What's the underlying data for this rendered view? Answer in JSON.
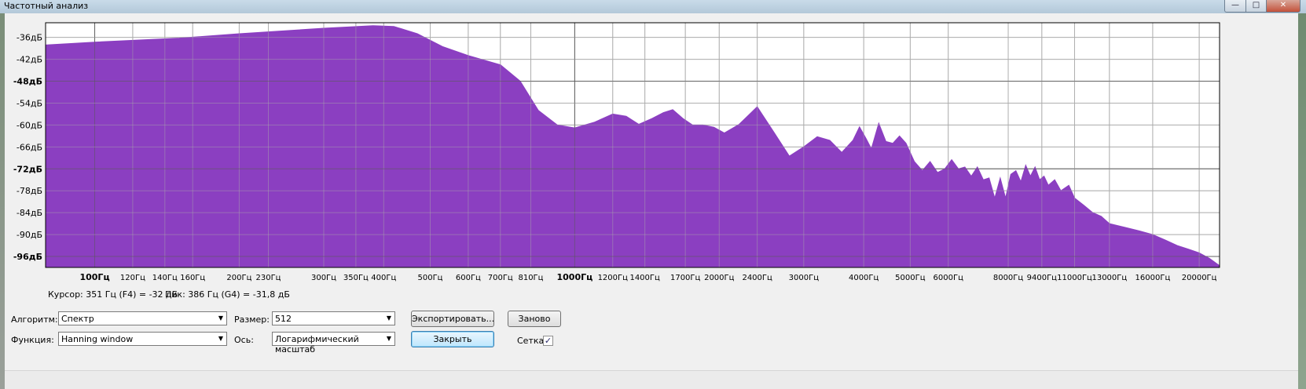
{
  "window": {
    "title": "Частотный анализ",
    "buttons": {
      "minimize": "—",
      "maximize": "□",
      "close": "✕"
    }
  },
  "spectrum": {
    "fill_color": "#8b3fc1",
    "y_labels": [
      "-36дБ",
      "-42дБ",
      "-48дБ",
      "-54дБ",
      "-60дБ",
      "-66дБ",
      "-72дБ",
      "-78дБ",
      "-84дБ",
      "-90дБ",
      "-96дБ"
    ],
    "y_bold": [
      "-48дБ",
      "-72дБ",
      "-96дБ"
    ],
    "x_labels": [
      {
        "hz": 100,
        "text": "100Гц",
        "bold": true
      },
      {
        "hz": 120,
        "text": "120Гц"
      },
      {
        "hz": 140,
        "text": "140Гц"
      },
      {
        "hz": 160,
        "text": "160Гц"
      },
      {
        "hz": 200,
        "text": "200Гц"
      },
      {
        "hz": 230,
        "text": "230Гц"
      },
      {
        "hz": 300,
        "text": "300Гц"
      },
      {
        "hz": 350,
        "text": "350Гц"
      },
      {
        "hz": 400,
        "text": "400Гц"
      },
      {
        "hz": 500,
        "text": "500Гц"
      },
      {
        "hz": 600,
        "text": "600Гц"
      },
      {
        "hz": 700,
        "text": "700Гц"
      },
      {
        "hz": 810,
        "text": "810Гц"
      },
      {
        "hz": 1000,
        "text": "1000Гц",
        "bold": true
      },
      {
        "hz": 1200,
        "text": "1200Гц"
      },
      {
        "hz": 1400,
        "text": "1400Гц"
      },
      {
        "hz": 1700,
        "text": "1700Гц"
      },
      {
        "hz": 2000,
        "text": "2000Гц"
      },
      {
        "hz": 2400,
        "text": "2400Гц"
      },
      {
        "hz": 3000,
        "text": "3000Гц"
      },
      {
        "hz": 4000,
        "text": "4000Гц"
      },
      {
        "hz": 5000,
        "text": "5000Гц"
      },
      {
        "hz": 6000,
        "text": "6000Гц"
      },
      {
        "hz": 8000,
        "text": "8000Гц"
      },
      {
        "hz": 9400,
        "text": "9400Гц"
      },
      {
        "hz": 11000,
        "text": "11000Гц"
      },
      {
        "hz": 13000,
        "text": "13000Гц"
      },
      {
        "hz": 16000,
        "text": "16000Гц"
      },
      {
        "hz": 20000,
        "text": "20000Гц"
      }
    ],
    "x_range_hz": [
      79,
      22050
    ],
    "y_range_db": [
      -32,
      -99
    ],
    "grid": true,
    "curve": [
      [
        79,
        -38.1
      ],
      [
        100,
        -37.3
      ],
      [
        150,
        -36.2
      ],
      [
        200,
        -35.0
      ],
      [
        300,
        -33.5
      ],
      [
        380,
        -32.8
      ],
      [
        420,
        -33.0
      ],
      [
        470,
        -35.0
      ],
      [
        530,
        -38.5
      ],
      [
        600,
        -41.0
      ],
      [
        700,
        -43.5
      ],
      [
        770,
        -48.0
      ],
      [
        840,
        -56.0
      ],
      [
        920,
        -60.0
      ],
      [
        1000,
        -60.8
      ],
      [
        1100,
        -59.2
      ],
      [
        1200,
        -57.0
      ],
      [
        1280,
        -57.6
      ],
      [
        1360,
        -59.8
      ],
      [
        1450,
        -58.2
      ],
      [
        1530,
        -56.6
      ],
      [
        1600,
        -55.8
      ],
      [
        1680,
        -58.2
      ],
      [
        1760,
        -60.0
      ],
      [
        1850,
        -60.0
      ],
      [
        1950,
        -60.6
      ],
      [
        2050,
        -62.2
      ],
      [
        2200,
        -59.8
      ],
      [
        2400,
        -55.0
      ],
      [
        2600,
        -62.0
      ],
      [
        2800,
        -68.5
      ],
      [
        3000,
        -66.0
      ],
      [
        3200,
        -63.2
      ],
      [
        3400,
        -64.2
      ],
      [
        3600,
        -67.5
      ],
      [
        3800,
        -64.2
      ],
      [
        3920,
        -60.5
      ],
      [
        4050,
        -63.8
      ],
      [
        4150,
        -66.5
      ],
      [
        4300,
        -59.5
      ],
      [
        4450,
        -64.5
      ],
      [
        4600,
        -65.0
      ],
      [
        4750,
        -63.0
      ],
      [
        4900,
        -65.0
      ],
      [
        5100,
        -70.0
      ],
      [
        5300,
        -72.5
      ],
      [
        5500,
        -70.0
      ],
      [
        5700,
        -73.0
      ],
      [
        5900,
        -72.0
      ],
      [
        6100,
        -69.5
      ],
      [
        6300,
        -72.0
      ],
      [
        6500,
        -71.5
      ],
      [
        6700,
        -74.0
      ],
      [
        6900,
        -71.5
      ],
      [
        7100,
        -75.0
      ],
      [
        7300,
        -74.5
      ],
      [
        7500,
        -80.0
      ],
      [
        7700,
        -74.5
      ],
      [
        7900,
        -80.0
      ],
      [
        8100,
        -73.5
      ],
      [
        8300,
        -72.5
      ],
      [
        8500,
        -75.5
      ],
      [
        8700,
        -71.0
      ],
      [
        8900,
        -74.0
      ],
      [
        9100,
        -71.5
      ],
      [
        9300,
        -75.0
      ],
      [
        9500,
        -74.0
      ],
      [
        9700,
        -76.5
      ],
      [
        10000,
        -75.0
      ],
      [
        10300,
        -78.0
      ],
      [
        10700,
        -76.5
      ],
      [
        11000,
        -80.0
      ],
      [
        11500,
        -82.0
      ],
      [
        12000,
        -84.0
      ],
      [
        12500,
        -85.0
      ],
      [
        13000,
        -87.0
      ],
      [
        14000,
        -88.0
      ],
      [
        15000,
        -89.0
      ],
      [
        16000,
        -90.0
      ],
      [
        17000,
        -91.5
      ],
      [
        18000,
        -93.0
      ],
      [
        19000,
        -94.0
      ],
      [
        20000,
        -95.0
      ],
      [
        21000,
        -96.5
      ],
      [
        22050,
        -98.5
      ]
    ]
  },
  "status": {
    "cursor": "Курсор: 351 Гц (F4) = -32 дБ",
    "peak": "Пик: 386 Гц (G4) = -31,8 дБ"
  },
  "controls": {
    "algorithm_label": "Алгоритм:",
    "algorithm_value": "Спектр",
    "function_label": "Функция:",
    "function_value": "Hanning window",
    "size_label": "Размер:",
    "size_value": "512",
    "axis_label": "Ось:",
    "axis_value": "Логарифмический масштаб",
    "export_button": "Экспортировать...",
    "replot_button": "Заново",
    "close_button": "Закрыть",
    "grid_label": "Сетка",
    "grid_checked": "✓",
    "dropdown_arrow": "▼"
  }
}
